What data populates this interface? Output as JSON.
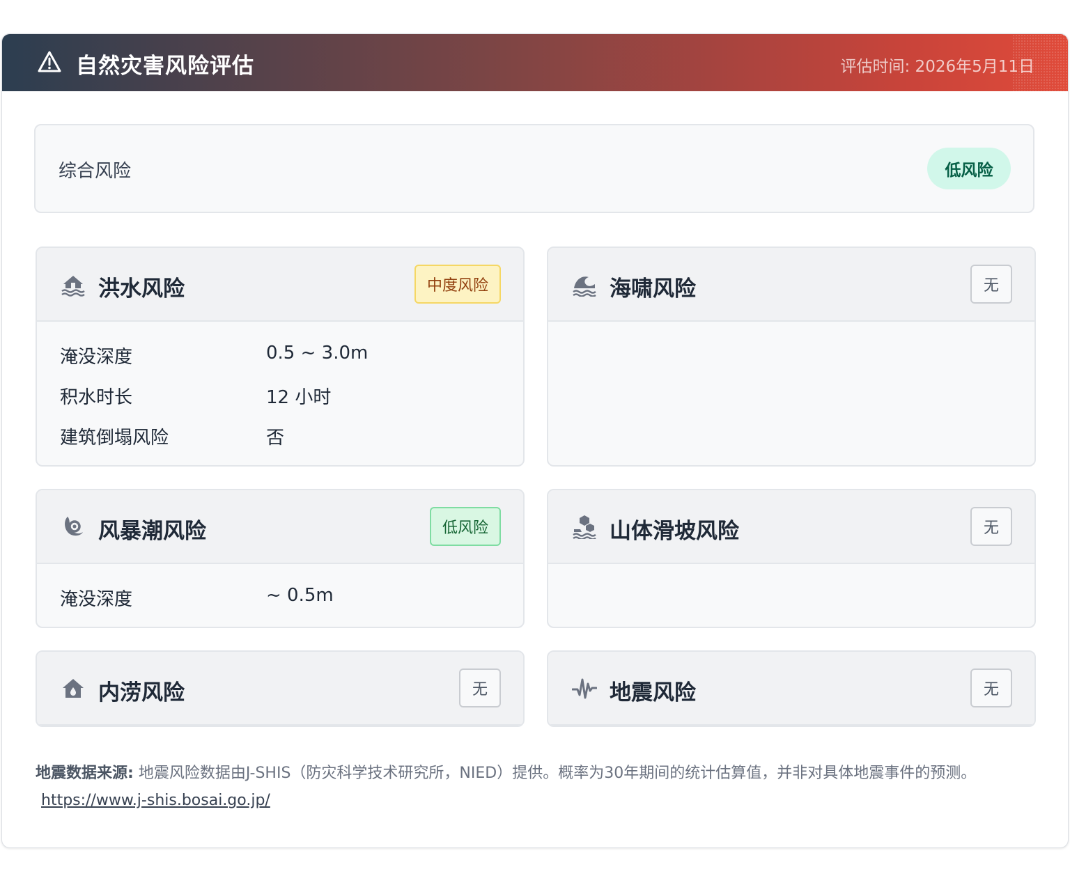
{
  "header": {
    "title": "自然灾害风险评估",
    "date": "评估时间: 2026年5月11日"
  },
  "overall": {
    "label": "综合风险",
    "badge": "低风险",
    "badge_color": "#d1f7ea"
  },
  "hazards": {
    "flood": {
      "icon": "house-flood-icon",
      "title": "洪水风险",
      "badge": "中度风险",
      "rows": [
        {
          "label": "淹没深度",
          "value": "0.5 ~ 3.0m"
        },
        {
          "label": "积水时长",
          "value": "12 小时"
        },
        {
          "label": "建筑倒塌风险",
          "value": "否"
        }
      ]
    },
    "tsunami": {
      "icon": "water-wave-icon",
      "title": "海啸风险",
      "badge": "无"
    },
    "storm_surge": {
      "icon": "hurricane-icon",
      "title": "风暴潮风险",
      "badge": "低风险",
      "rows": [
        {
          "label": "淹没深度",
          "value": "~ 0.5m"
        }
      ]
    },
    "landslide": {
      "icon": "hill-rockslide-icon",
      "title": "山体滑坡风险",
      "badge": "无"
    },
    "inland": {
      "icon": "house-water-icon",
      "title": "内涝风险",
      "badge": "无"
    },
    "earthquake": {
      "icon": "seismic-wave-icon",
      "title": "地震风险",
      "badge": "无"
    }
  },
  "footer": {
    "source_label": "地震数据来源:",
    "source_text": "地震风险数据由J-SHIS（防灾科学技术研究所，NIED）提供。概率为30年期间的统计估算值，并非对具体地震事件的预测。",
    "link": "https://www.j-shis.bosai.go.jp/"
  },
  "colors": {
    "header_start": "#2c3e50",
    "header_end": "#e04b3a",
    "medium_badge": "#fdf3c3",
    "low_badge": "#d9f7e3"
  }
}
